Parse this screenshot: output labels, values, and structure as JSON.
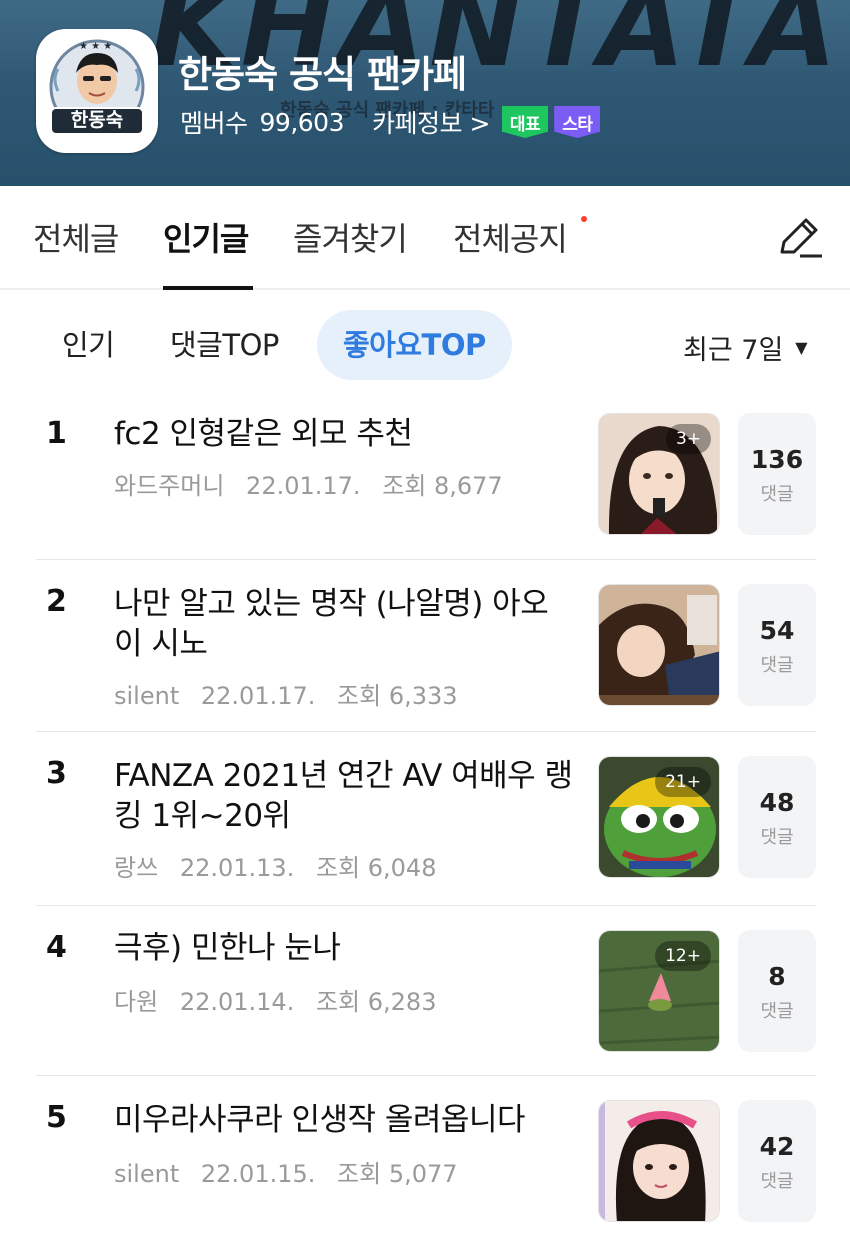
{
  "banner": {
    "bg_text": "KHANTATA",
    "bg_sub": "한동숙 공식 팬카페 : 칸타타",
    "logo_label": "한동숙",
    "cafe_title": "한동숙 공식 팬카페",
    "members_label": "멤버수",
    "members_count": "99,603",
    "cafe_info_label": "카페정보 >",
    "badge_rep": "대표",
    "badge_star": "스타",
    "colors": {
      "badge_rep": "#1ec65f",
      "badge_star": "#7b5cf5"
    }
  },
  "tabs": [
    {
      "label": "전체글"
    },
    {
      "label": "인기글"
    },
    {
      "label": "즐겨찾기"
    },
    {
      "label": "전체공지"
    }
  ],
  "active_tab": "인기글",
  "write_icon": "pencil-icon",
  "filters": {
    "chips": [
      "인기",
      "댓글TOP",
      "좋아요TOP"
    ],
    "active_chip": "좋아요TOP",
    "period": "최근 7일",
    "accent": "#2f7be0"
  },
  "posts": [
    {
      "rank": "1",
      "title": "fc2 인형같은 외모 추천",
      "author": "와드주머니",
      "date": "22.01.17.",
      "views": "조회 8,677",
      "thumb_count": "3+",
      "comments": "136",
      "comments_label": "댓글"
    },
    {
      "rank": "2",
      "title": "나만 알고 있는 명작 (나알명) 아오이 시노",
      "author": "silent",
      "date": "22.01.17.",
      "views": "조회 6,333",
      "thumb_count": "",
      "comments": "54",
      "comments_label": "댓글"
    },
    {
      "rank": "3",
      "title": "FANZA 2021년 연간 AV 여배우 랭킹 1위~20위",
      "author": "랑쓰",
      "date": "22.01.13.",
      "views": "조회 6,048",
      "thumb_count": "21+",
      "comments": "48",
      "comments_label": "댓글"
    },
    {
      "rank": "4",
      "title": "극후) 민한나 눈나",
      "author": "다원",
      "date": "22.01.14.",
      "views": "조회 6,283",
      "thumb_count": "12+",
      "comments": "8",
      "comments_label": "댓글"
    },
    {
      "rank": "5",
      "title": "미우라사쿠라 인생작 올려옵니다",
      "author": "silent",
      "date": "22.01.15.",
      "views": "조회 5,077",
      "thumb_count": "",
      "comments": "42",
      "comments_label": "댓글"
    }
  ]
}
